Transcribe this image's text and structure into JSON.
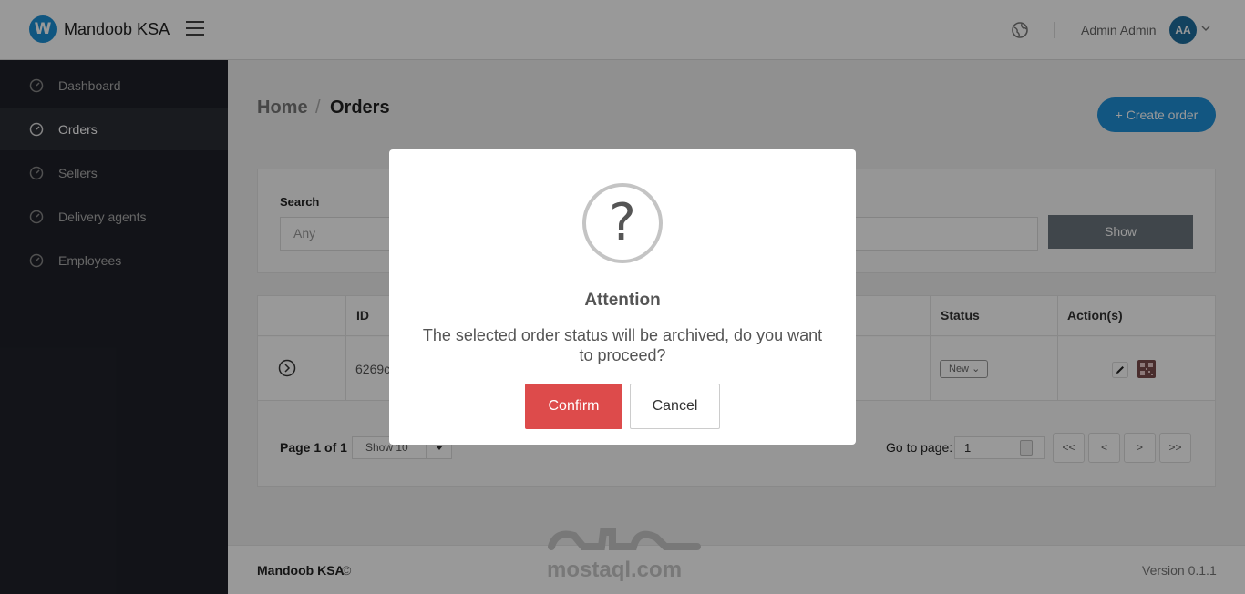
{
  "header": {
    "logo_letter": "W",
    "brand": "Mandoob KSA",
    "user_name": "Admin Admin",
    "avatar_initials": "AA",
    "accent": "#1c8fd6"
  },
  "sidebar": {
    "items": [
      {
        "label": "Dashboard",
        "icon": "gauge-icon",
        "active": false
      },
      {
        "label": "Orders",
        "icon": "gauge-icon",
        "active": true
      },
      {
        "label": "Sellers",
        "icon": "gauge-icon",
        "active": false
      },
      {
        "label": "Delivery agents",
        "icon": "gauge-icon",
        "active": false
      },
      {
        "label": "Employees",
        "icon": "gauge-icon",
        "active": false
      }
    ]
  },
  "breadcrumb": {
    "home": "Home",
    "separator": "/",
    "current": "Orders"
  },
  "create_button": "+ Create order",
  "filters": {
    "search_label": "Search",
    "search_placeholder": "Any",
    "show_button": "Show"
  },
  "table": {
    "columns": [
      "ID",
      "Status",
      "Action(s)"
    ],
    "rows": [
      {
        "id": "6269c",
        "status": "New"
      }
    ]
  },
  "pagination": {
    "page_info": "Page 1 of 1",
    "page_size": "Show 10",
    "goto_label": "Go to page:",
    "goto_value": "1",
    "buttons": [
      "<<",
      "<",
      ">",
      ">>"
    ]
  },
  "footer": {
    "brand": "Mandoob KSA",
    "copyright": "©",
    "version": "Version 0.1.1"
  },
  "watermark": {
    "text": "mostaql.com"
  },
  "modal": {
    "icon": "?",
    "title": "Attention",
    "message": "The selected order status will be archived, do you want to proceed?",
    "confirm": "Confirm",
    "cancel": "Cancel",
    "confirm_color": "#dd4b4b"
  }
}
